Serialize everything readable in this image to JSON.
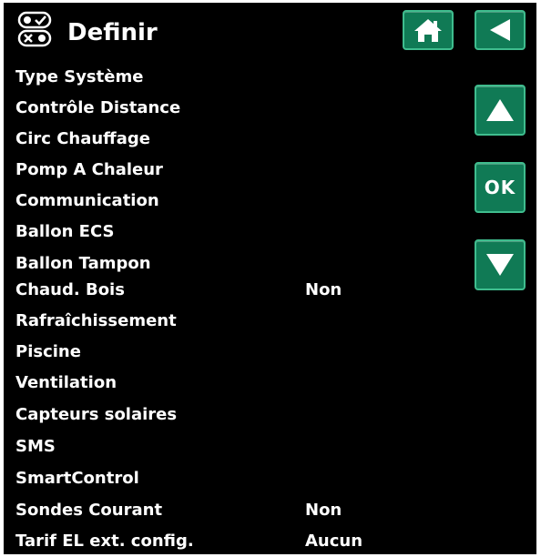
{
  "header": {
    "title": "Definir",
    "icon": "settings-toggles-icon"
  },
  "buttons": {
    "home_icon": "home-icon",
    "back_icon": "back-arrow-icon",
    "up_icon": "up-arrow-icon",
    "ok_label": "OK",
    "down_icon": "down-arrow-icon"
  },
  "menu": {
    "items": [
      {
        "label": "Type Système",
        "value": ""
      },
      {
        "label": "Contrôle Distance",
        "value": ""
      },
      {
        "label": "Circ Chauffage",
        "value": ""
      },
      {
        "label": "Pomp A Chaleur",
        "value": ""
      },
      {
        "label": "Communication",
        "value": ""
      },
      {
        "label": "Ballon ECS",
        "value": ""
      },
      {
        "label": "Ballon Tampon",
        "value": ""
      },
      {
        "label": "Chaud. Bois",
        "value": "Non"
      },
      {
        "label": "Rafraîchissement",
        "value": ""
      },
      {
        "label": "Piscine",
        "value": ""
      },
      {
        "label": "Ventilation",
        "value": ""
      },
      {
        "label": "Capteurs solaires",
        "value": ""
      },
      {
        "label": "SMS",
        "value": ""
      },
      {
        "label": "SmartControl",
        "value": ""
      },
      {
        "label": "Sondes Courant",
        "value": "Non"
      },
      {
        "label": "Tarif EL ext. config.",
        "value": "Aucun"
      }
    ]
  },
  "colors": {
    "background": "#000000",
    "text": "#ffffff",
    "button": "#107a55",
    "button_border": "#3fbd8e"
  }
}
